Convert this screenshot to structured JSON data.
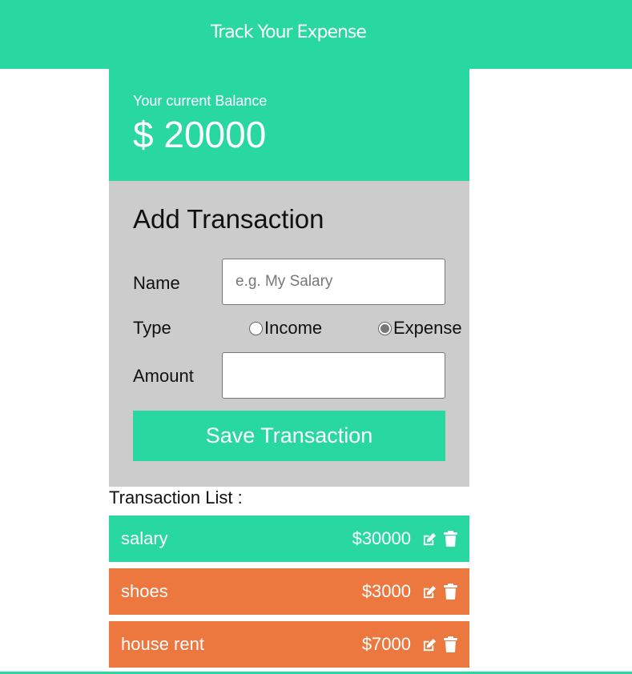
{
  "header": {
    "title": "Track Your Expense"
  },
  "balance": {
    "label": "Your current Balance",
    "value": "$ 20000"
  },
  "form": {
    "title": "Add Transaction",
    "name_label": "Name",
    "name_placeholder": "e.g. My Salary",
    "name_value": "",
    "type_label": "Type",
    "type_options": [
      {
        "label": "Income",
        "checked": false
      },
      {
        "label": "Expense",
        "checked": true
      }
    ],
    "amount_label": "Amount",
    "amount_value": "",
    "save_label": "Save Transaction"
  },
  "list": {
    "title": "Transaction List :",
    "items": [
      {
        "name": "salary",
        "amount": "$30000",
        "type": "income"
      },
      {
        "name": "shoes",
        "amount": "$3000",
        "type": "expense"
      },
      {
        "name": "house rent",
        "amount": "$7000",
        "type": "expense"
      }
    ]
  },
  "colors": {
    "income": "#28d8a0",
    "expense": "#ec773f",
    "form_bg": "#cccccc"
  },
  "icons": {
    "edit": "edit-icon",
    "delete": "trash-icon"
  }
}
